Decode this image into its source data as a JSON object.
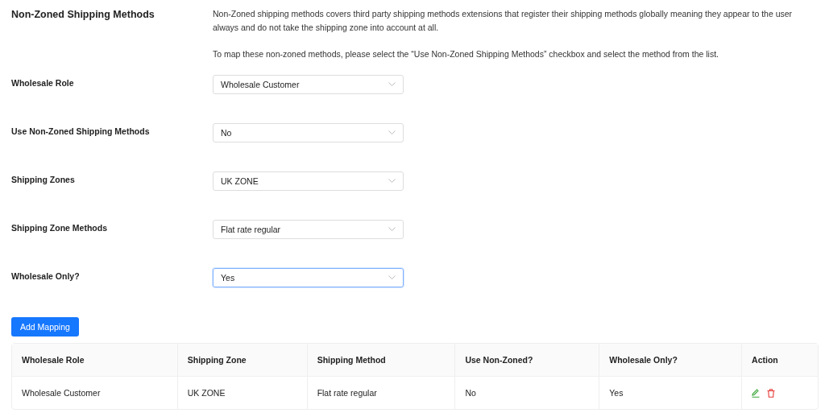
{
  "section": {
    "title": "Non-Zoned Shipping Methods",
    "description": [
      "Non-Zoned shipping methods covers third party shipping methods extensions that register their shipping methods globally meaning they appear to the user always and do not take the shipping zone into account at all.",
      "To map these non-zoned methods, please select the “Use Non-Zoned Shipping Methods” checkbox and select the method from the list."
    ]
  },
  "fields": [
    {
      "label": "Wholesale Role",
      "value": "Wholesale Customer",
      "focused": false
    },
    {
      "label": "Use Non-Zoned Shipping Methods",
      "value": "No",
      "focused": false
    },
    {
      "label": "Shipping Zones",
      "value": "UK ZONE",
      "focused": false
    },
    {
      "label": "Shipping Zone Methods",
      "value": "Flat rate regular",
      "focused": false
    },
    {
      "label": "Wholesale Only?",
      "value": "Yes",
      "focused": true
    }
  ],
  "add_button": "Add Mapping",
  "table": {
    "columns": [
      "Wholesale Role",
      "Shipping Zone",
      "Shipping Method",
      "Use Non-Zoned?",
      "Wholesale Only?",
      "Action"
    ],
    "rows": [
      {
        "cells": [
          "Wholesale Customer",
          "UK ZONE",
          "Flat rate regular",
          "No",
          "Yes"
        ]
      }
    ]
  }
}
